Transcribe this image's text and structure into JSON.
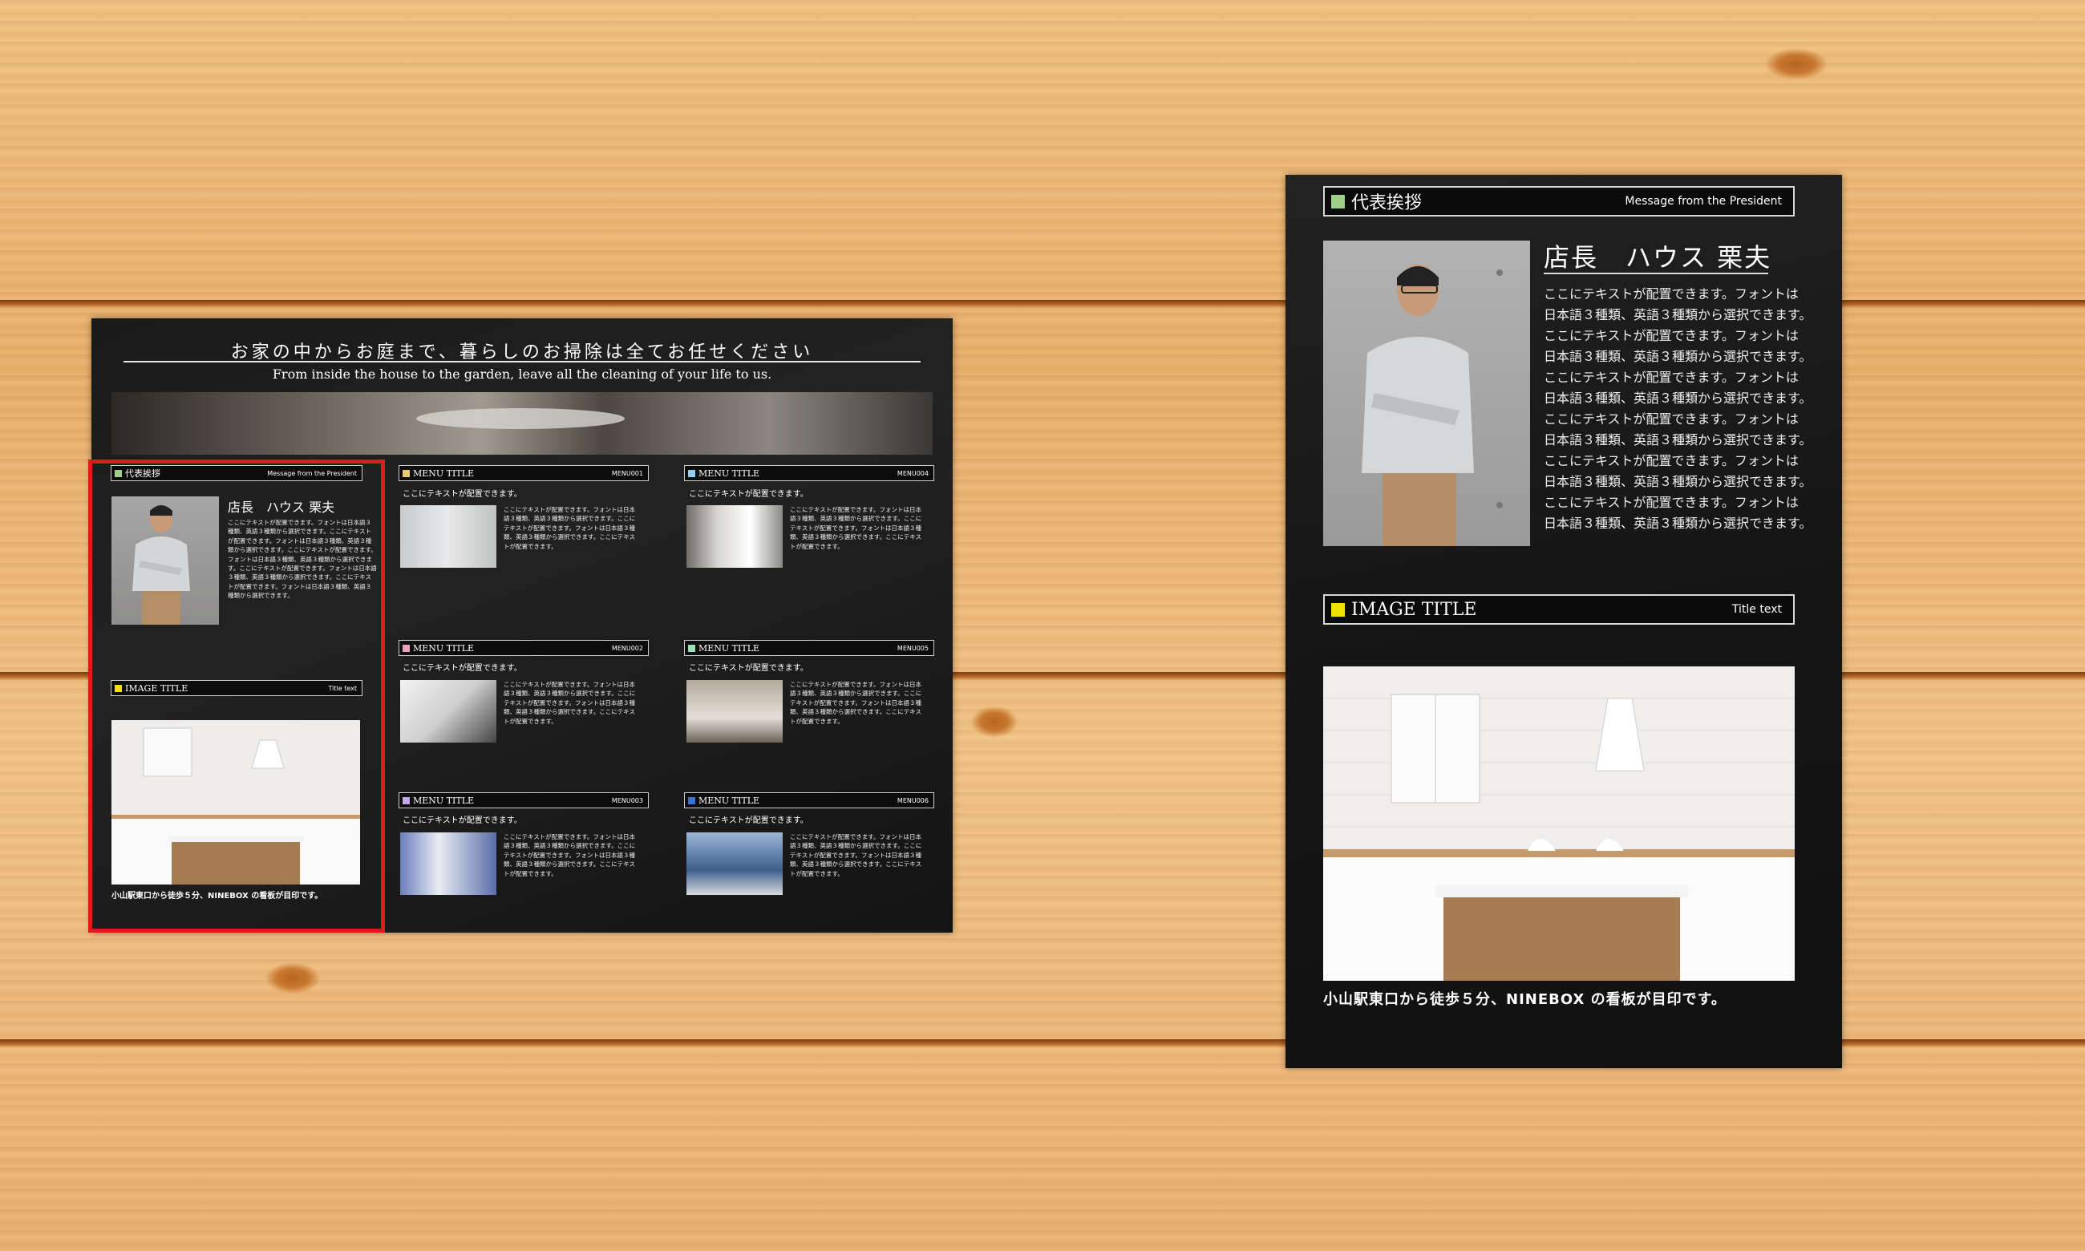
{
  "spread": {
    "headline_jp": "お家の中からお庭まで、暮らしのお掃除は全てお任せください",
    "headline_en": "From inside the house to the garden, leave all the cleaning of your life to us.",
    "president": {
      "title": "代表挨拶",
      "subtitle": "Message from the President",
      "name": "店長　ハウス 栗夫",
      "body": "ここにテキストが配置できます。フォントは日本語３種類、英語３種類から選択できます。ここにテキストが配置できます。フォントは日本語３種類、英語３種類から選択できます。ここにテキストが配置できます。フォントは日本語３種類、英語３種類から選択できます。ここにテキストが配置できます。フォントは日本語３種類、英語３種類から選択できます。ここにテキストが配置できます。フォントは日本語３種類、英語３種類から選択できます。"
    },
    "image_section": {
      "title": "IMAGE TITLE",
      "subtitle": "Title text",
      "caption": "小山駅東口から徒歩５分、NINEBOX の看板が目印です。"
    },
    "menus": [
      {
        "title": "MENU TITLE",
        "code": "MENU001",
        "lead": "ここにテキストが配置できます。",
        "body": "ここにテキストが配置できます。フォントは日本語３種類、英語３種類から選択できます。ここにテキストが配置できます。フォントは日本語３種類、英語３種類から選択できます。ここにテキストが配置できます。",
        "color": "#e8c96e"
      },
      {
        "title": "MENU TITLE",
        "code": "MENU004",
        "lead": "ここにテキストが配置できます。",
        "body": "ここにテキストが配置できます。フォントは日本語３種類、英語３種類から選択できます。ここにテキストが配置できます。フォントは日本語３種類、英語３種類から選択できます。ここにテキストが配置できます。",
        "color": "#8fd3e8"
      },
      {
        "title": "MENU TITLE",
        "code": "MENU002",
        "lead": "ここにテキストが配置できます。",
        "body": "ここにテキストが配置できます。フォントは日本語３種類、英語３種類から選択できます。ここにテキストが配置できます。フォントは日本語３種類、英語３種類から選択できます。ここにテキストが配置できます。",
        "color": "#e6a0c0"
      },
      {
        "title": "MENU TITLE",
        "code": "MENU005",
        "lead": "ここにテキストが配置できます。",
        "body": "ここにテキストが配置できます。フォントは日本語３種類、英語３種類から選択できます。ここにテキストが配置できます。フォントは日本語３種類、英語３種類から選択できます。ここにテキストが配置できます。",
        "color": "#9fdcb8"
      },
      {
        "title": "MENU TITLE",
        "code": "MENU003",
        "lead": "ここにテキストが配置できます。",
        "body": "ここにテキストが配置できます。フォントは日本語３種類、英語３種類から選択できます。ここにテキストが配置できます。フォントは日本語３種類、英語３種類から選択できます。ここにテキストが配置できます。",
        "color": "#c7a8e6"
      },
      {
        "title": "MENU TITLE",
        "code": "MENU006",
        "lead": "ここにテキストが配置できます。",
        "body": "ここにテキストが配置できます。フォントは日本語３種類、英語３種類から選択できます。ここにテキストが配置できます。フォントは日本語３種類、英語３種類から選択できます。ここにテキストが配置できます。",
        "color": "#3e6fd6"
      }
    ]
  },
  "panel": {
    "president": {
      "title": "代表挨拶",
      "subtitle": "Message from the President",
      "name": "店長　ハウス 栗夫",
      "lines": [
        "ここにテキストが配置できます。フォントは",
        "日本語３種類、英語３種類から選択できます。",
        "ここにテキストが配置できます。フォントは",
        "日本語３種類、英語３種類から選択できます。",
        "ここにテキストが配置できます。フォントは",
        "日本語３種類、英語３種類から選択できます。",
        "ここにテキストが配置できます。フォントは",
        "日本語３種類、英語３種類から選択できます。",
        "ここにテキストが配置できます。フォントは",
        "日本語３種類、英語３種類から選択できます。",
        "ここにテキストが配置できます。フォントは",
        "日本語３種類、英語３種類から選択できます。"
      ]
    },
    "image_section": {
      "title": "IMAGE TITLE",
      "subtitle": "Title text",
      "caption": "小山駅東口から徒歩５分、NINEBOX の看板が目印です。"
    }
  },
  "colors": {
    "highlight": "#e01b1b",
    "president_square": "#9fd08a",
    "image_square": "#f2e000"
  }
}
